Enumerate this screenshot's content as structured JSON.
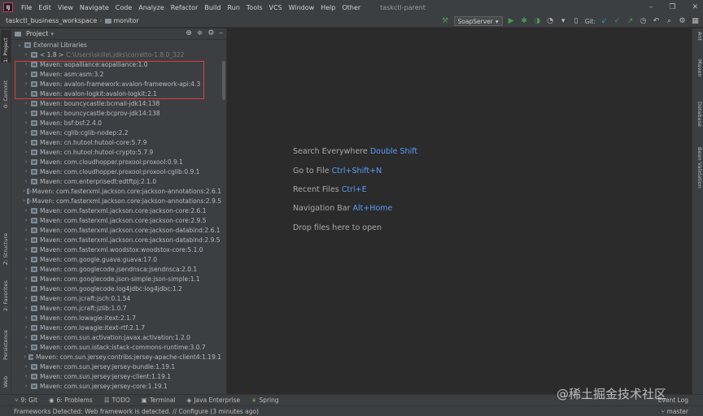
{
  "menubar": {
    "items": [
      "File",
      "Edit",
      "View",
      "Navigate",
      "Code",
      "Analyze",
      "Refactor",
      "Build",
      "Run",
      "Tools",
      "VCS",
      "Window",
      "Help",
      "Other"
    ],
    "window_title": "taskctl-parent"
  },
  "navbar": {
    "project": "taskctl_business_workspace",
    "module": "monitor",
    "run_config": "SoapServer",
    "git_label": "Git:"
  },
  "left_strip": {
    "tabs": [
      "1: Project",
      "0: Commit",
      "Z: Structure",
      "2: Favorites",
      "Persistence",
      "Web"
    ]
  },
  "right_strip": {
    "tabs": [
      "Ant",
      "Maven",
      "Database",
      "Bean Validation"
    ]
  },
  "project_panel": {
    "title": "Project",
    "root": "External Libraries",
    "jdk_label": "< 1.8 >",
    "jdk_path": "C:\\Users\\skille\\.jdks\\corretto-1.8.0_322",
    "libraries": [
      "Maven: aopalliance:aopalliance:1.0",
      "Maven: asm:asm:3.2",
      "Maven: avalon-framework:avalon-framework-api:4.3",
      "Maven: avalon-logkit:avalon-logkit:2.1",
      "Maven: bouncycastle:bcmail-jdk14:138",
      "Maven: bouncycastle:bcprov-jdk14:138",
      "Maven: bsf:bsf:2.4.0",
      "Maven: cglib:cglib-nodep:2.2",
      "Maven: cn.hutool:hutool-core:5.7.9",
      "Maven: cn.hutool:hutool-crypto:5.7.9",
      "Maven: com.cloudhopper.proxool:proxool:0.9.1",
      "Maven: com.cloudhopper.proxool:proxool-cglib:0.9.1",
      "Maven: com.enterprisedt:edtftpj:2.1.0",
      "Maven: com.fasterxml.jackson.core:jackson-annotations:2.6.1",
      "Maven: com.fasterxml.jackson.core:jackson-annotations:2.9.5",
      "Maven: com.fasterxml.jackson.core:jackson-core:2.6.1",
      "Maven: com.fasterxml.jackson.core:jackson-core:2.9.5",
      "Maven: com.fasterxml.jackson.core:jackson-databind:2.6.1",
      "Maven: com.fasterxml.jackson.core:jackson-databind:2.9.5",
      "Maven: com.fasterxml.woodstox:woodstox-core:5.1.0",
      "Maven: com.google.guava:guava:17.0",
      "Maven: com.googlecode.jsendnsca:jsendnsca:2.0.1",
      "Maven: com.googlecode.json-simple:json-simple:1.1",
      "Maven: com.googlecode.log4jdbc:log4jdbc:1.2",
      "Maven: com.jcraft:jsch:0.1.54",
      "Maven: com.jcraft:jzlib:1.0.7",
      "Maven: com.lowagie:itext:2.1.7",
      "Maven: com.lowagie:itext-rtf:2.1.7",
      "Maven: com.sun.activation:javax.activation:1.2.0",
      "Maven: com.sun.istack:istack-commons-runtime:3.0.7",
      "Maven: com.sun.jersey.contribs:jersey-apache-client4:1.19.1",
      "Maven: com.sun.jersey:jersey-bundle:1.19.1",
      "Maven: com.sun.jersey:jersey-client:1.19.1",
      "Maven: com.sun.jersey:jersey-core:1.19.1"
    ]
  },
  "editor": {
    "hints": [
      {
        "label": "Search Everywhere",
        "key": "Double Shift"
      },
      {
        "label": "Go to File",
        "key": "Ctrl+Shift+N"
      },
      {
        "label": "Recent Files",
        "key": "Ctrl+E"
      },
      {
        "label": "Navigation Bar",
        "key": "Alt+Home"
      },
      {
        "label": "Drop files here to open",
        "key": ""
      }
    ]
  },
  "tool_tabs": {
    "items": [
      "9: Git",
      "6: Problems",
      "TODO",
      "Terminal",
      "Java Enterprise",
      "Spring"
    ],
    "event_log": "Event Log"
  },
  "statusbar": {
    "message": "Frameworks Detected: Web framework is detected. // Configure (3 minutes ago)",
    "branch": "master"
  },
  "watermark": "@稀土掘金技术社区",
  "colors": {
    "background": "#2b2b2b",
    "panel": "#3c3f41",
    "accent_key": "#589df6",
    "highlight_border": "#e03b3b",
    "run_green": "#499c54"
  }
}
